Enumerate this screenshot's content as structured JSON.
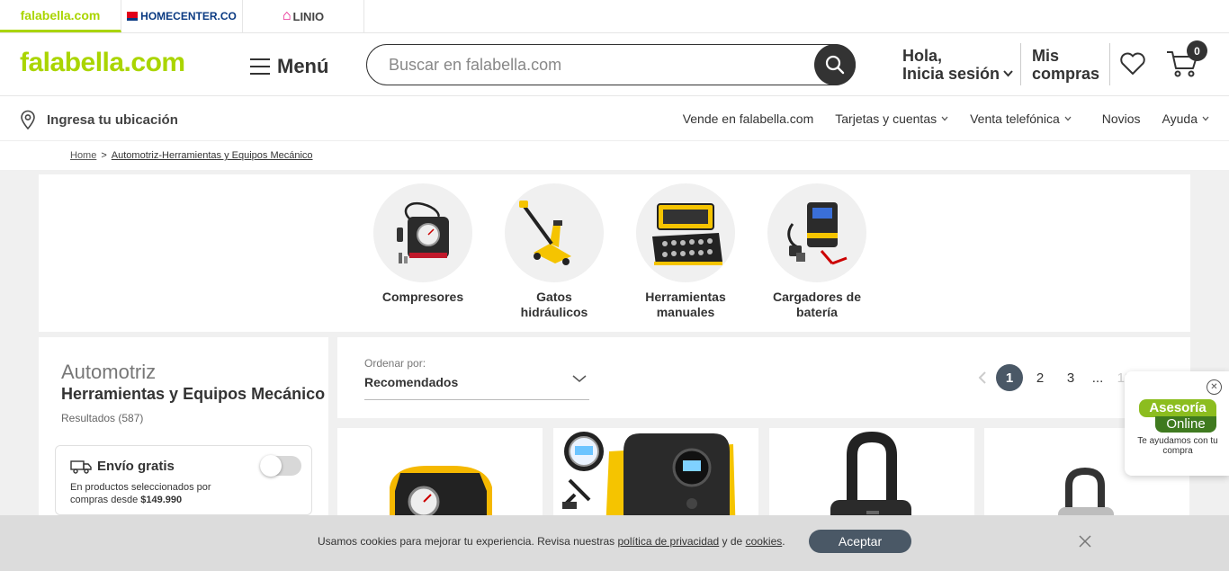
{
  "brands": [
    {
      "label": "falabella.com"
    },
    {
      "label": "HOMECENTER.CO"
    },
    {
      "label": "LINIO"
    }
  ],
  "header": {
    "logo": "falabella.com",
    "menu_label": "Menú",
    "search_placeholder": "Buscar en falabella.com",
    "account_line1": "Hola,",
    "account_line2": "Inicia sesión",
    "orders_line1": "Mis",
    "orders_line2": "compras",
    "cart_count": "0"
  },
  "subnav": {
    "location": "Ingresa tu ubicación",
    "links": [
      {
        "label": "Vende en falabella.com",
        "dropdown": false
      },
      {
        "label": "Tarjetas y cuentas",
        "dropdown": true
      },
      {
        "label": "Venta telefónica",
        "dropdown": true
      },
      {
        "label": "Novios",
        "dropdown": false
      },
      {
        "label": "Ayuda",
        "dropdown": true
      }
    ]
  },
  "breadcrumb": {
    "home": "Home",
    "separator": ">",
    "current": "Automotriz-Herramientas y Equipos Mecánico"
  },
  "categories": [
    {
      "name": "Compresores"
    },
    {
      "name": "Gatos hidráulicos"
    },
    {
      "name": "Herramientas manuales"
    },
    {
      "name": "Cargadores de batería"
    }
  ],
  "sidebar": {
    "category": "Automotriz",
    "subcategory": "Herramientas y Equipos Mecánico",
    "results": "Resultados (587)",
    "free_shipping": {
      "title": "Envío gratis",
      "desc_prefix": "En productos seleccionados por compras desde ",
      "desc_amount": "$149.990",
      "enabled": false
    }
  },
  "sort": {
    "label": "Ordenar por:",
    "value": "Recomendados"
  },
  "pagination": {
    "pages": [
      "1",
      "2",
      "3"
    ],
    "ellipsis": "...",
    "last": "13",
    "current": "1"
  },
  "chat": {
    "line1": "Asesoría",
    "line2": "Online",
    "tagline": "Te ayudamos con tu compra"
  },
  "cookie": {
    "text_prefix": "Usamos cookies para mejorar tu experiencia. Revisa nuestras ",
    "privacy_link": "política de privacidad",
    "text_middle": " y de ",
    "cookies_link": "cookies",
    "text_suffix": ".",
    "accept_label": "Aceptar"
  },
  "colors": {
    "brand_green": "#aad500",
    "dark": "#333333",
    "pager_active": "#4a5866"
  }
}
